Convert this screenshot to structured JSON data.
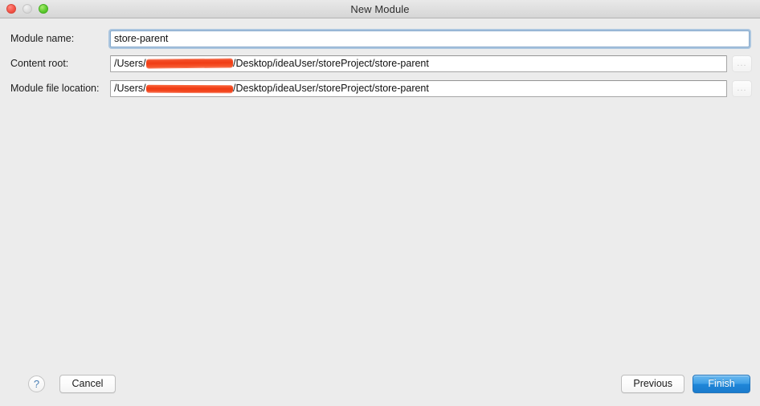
{
  "window": {
    "title": "New Module",
    "traffic_lights": [
      {
        "name": "close",
        "color": "#f5564a"
      },
      {
        "name": "minimize",
        "color": "#dcdcdc"
      },
      {
        "name": "zoom",
        "color": "#5fcc30"
      }
    ]
  },
  "form": {
    "module_name": {
      "label": "Module name:",
      "value": "store-parent",
      "placeholder": "",
      "focused": true
    },
    "content_root": {
      "label": "Content root:",
      "prefix": "/Users/",
      "redacted_user": "redacted-username",
      "suffix": "/Desktop/ideaUser/storeProject/store-parent",
      "browse_label": "...",
      "redaction_color": "#f4451c"
    },
    "module_file_location": {
      "label": "Module file location:",
      "prefix": "/Users/",
      "redacted_user": "redacted-username",
      "suffix": "/Desktop/ideaUser/storeProject/store-parent",
      "browse_label": "...",
      "redaction_color": "#f4451c"
    }
  },
  "footer": {
    "help_label": "?",
    "cancel_label": "Cancel",
    "previous_label": "Previous",
    "finish_label": "Finish",
    "primary_color": "#1f86d8"
  }
}
